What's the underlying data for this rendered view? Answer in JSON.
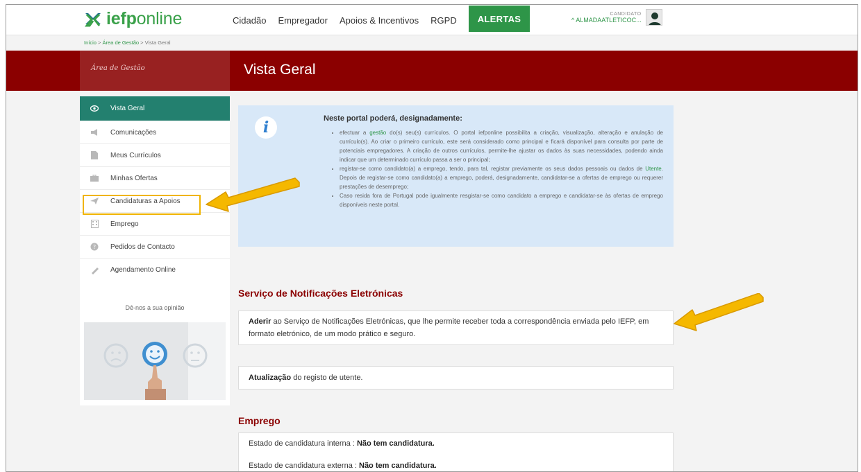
{
  "header": {
    "logo_bold": "iefp",
    "logo_rest": "online",
    "nav": [
      "Cidadão",
      "Empregador",
      "Apoios & Incentivos",
      "RGPD"
    ],
    "alert_label": "ALERTAS",
    "user_role": "CANDIDATO",
    "user_name": "ALMADAATLETICOC..."
  },
  "breadcrumb": {
    "items": [
      "Início",
      "Área de Gestão",
      "Vista Geral"
    ],
    "separator": ">"
  },
  "band": {
    "area_label": "Área de Gestão",
    "page_title": "Vista Geral"
  },
  "sidebar": {
    "items": [
      {
        "label": "Vista Geral",
        "icon": "eye-icon"
      },
      {
        "label": "Comunicações",
        "icon": "megaphone-icon"
      },
      {
        "label": "Meus Currículos",
        "icon": "document-icon"
      },
      {
        "label": "Minhas Ofertas",
        "icon": "briefcase-icon"
      },
      {
        "label": "Candidaturas a Apoios",
        "icon": "send-icon"
      },
      {
        "label": "Emprego",
        "icon": "building-icon"
      },
      {
        "label": "Pedidos de Contacto",
        "icon": "help-icon"
      },
      {
        "label": "Agendamento Online",
        "icon": "ticket-icon"
      }
    ],
    "opinion_label": "Dê-nos a sua opinião"
  },
  "info": {
    "heading": "Neste portal poderá, designadamente:",
    "b1_pre": "efectuar a ",
    "b1_link": "gestão",
    "b1_post": " do(s) seu(s) currículos. O portal iefponline possibilita a criação, visualização, alteração e anulação de currículo(s). Ao criar o primeiro currículo, este será considerado como principal e ficará disponível para consulta por parte de potenciais empregadores. A criação de outros currículos, permite-lhe ajustar os dados às suas necessidades, podendo ainda indicar que um determinado currículo passa a ser o principal;",
    "b2_pre": "registar-se como candidato(a) a emprego, tendo, para tal, registar previamente os seus dados pessoais ou dados de ",
    "b2_link": "Utente",
    "b2_post": ". Depois de registar-se como candidato(a) a emprego, poderá, designadamente, candidatar-se a ofertas de emprego ou requerer prestações de desemprego;",
    "b3": "Caso resida fora de Portugal pode igualmente resgistar-se como candidato a emprego e candidatar-se às ofertas de emprego disponíveis neste portal."
  },
  "notifications": {
    "title": "Serviço de Notificações Eletrónicas",
    "link": "Aderir",
    "text": " ao Serviço de Notificações Eletrónicas, que lhe permite receber toda a correspondência enviada pelo IEFP, em formato eletrónico, de um modo prático e seguro."
  },
  "update": {
    "link": "Atualização",
    "text": " do registo de utente."
  },
  "emprego": {
    "title": "Emprego",
    "internal_label": "Estado de candidatura interna : ",
    "internal_value": "Não tem candidatura.",
    "external_label": "Estado de candidatura externa : ",
    "external_value": "Não tem candidatura."
  },
  "colors": {
    "brand_green": "#2e9548",
    "band_red": "#8b0000",
    "active_teal": "#23806f",
    "info_blue": "#d8e8f8",
    "annotation_arrow": "#f0b400"
  }
}
